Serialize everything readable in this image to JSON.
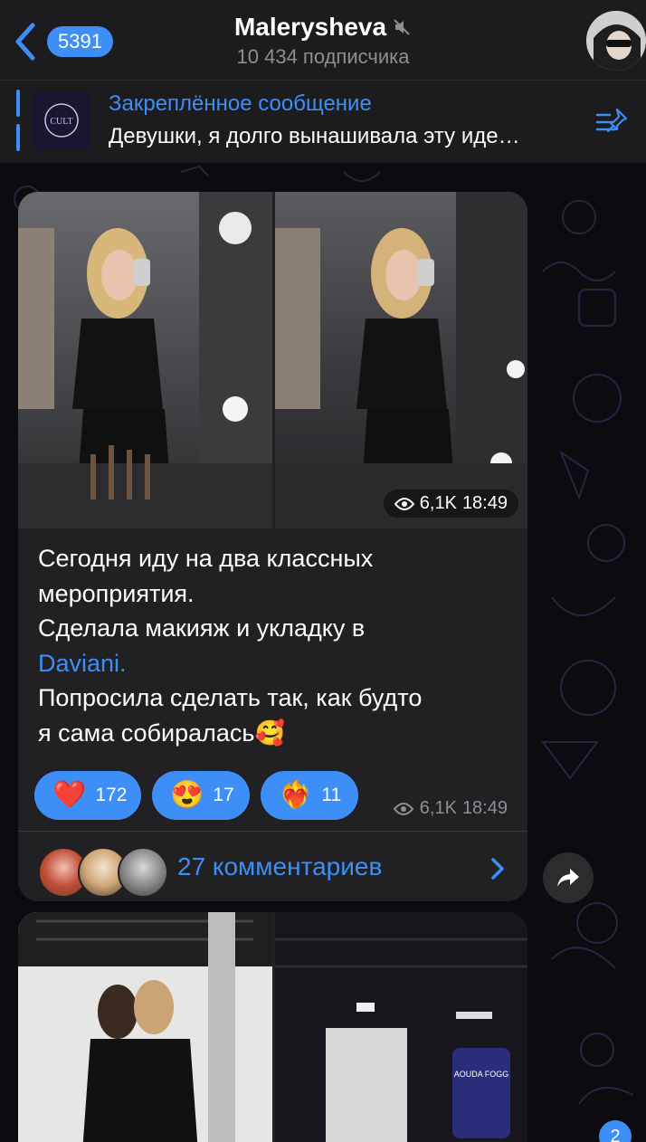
{
  "header": {
    "back_count": "5391",
    "title": "Malerysheva",
    "subtitle": "10 434 подписчика"
  },
  "pinned": {
    "title": "Закреплённое сообщение",
    "text": "Девушки, я долго вынашивала эту иде…",
    "thumb_text": "CULT"
  },
  "post": {
    "media_views": "6,1K",
    "media_time": "18:49",
    "text_line1": "Сегодня иду на два классных",
    "text_line2": "мероприятия.",
    "text_line3": "Сделала макияж и укладку в",
    "text_link": "Daviani.",
    "text_line5": "Попросила сделать так, как будто",
    "text_line6": "я сама собиралась🥰",
    "reactions": [
      {
        "emoji": "❤️",
        "count": "172"
      },
      {
        "emoji": "😍",
        "count": "17"
      },
      {
        "emoji": "❤️‍🔥",
        "count": "11"
      }
    ],
    "views": "6,1K",
    "time": "18:49",
    "comments_label": "27 комментариев"
  },
  "post2": {
    "poster_text": "AOUDA FOGG"
  },
  "unread": "2",
  "icons": {
    "back": "chevron-left-icon",
    "mute": "mute-icon",
    "pin": "pin-list-icon",
    "eye": "eye-icon",
    "share": "share-arrow-icon",
    "chevron": "chevron-right-icon"
  },
  "colors": {
    "accent": "#3e8ef7",
    "header_bg": "#1c1c1e",
    "bubble_bg": "#212124",
    "background": "#0b0b10"
  }
}
